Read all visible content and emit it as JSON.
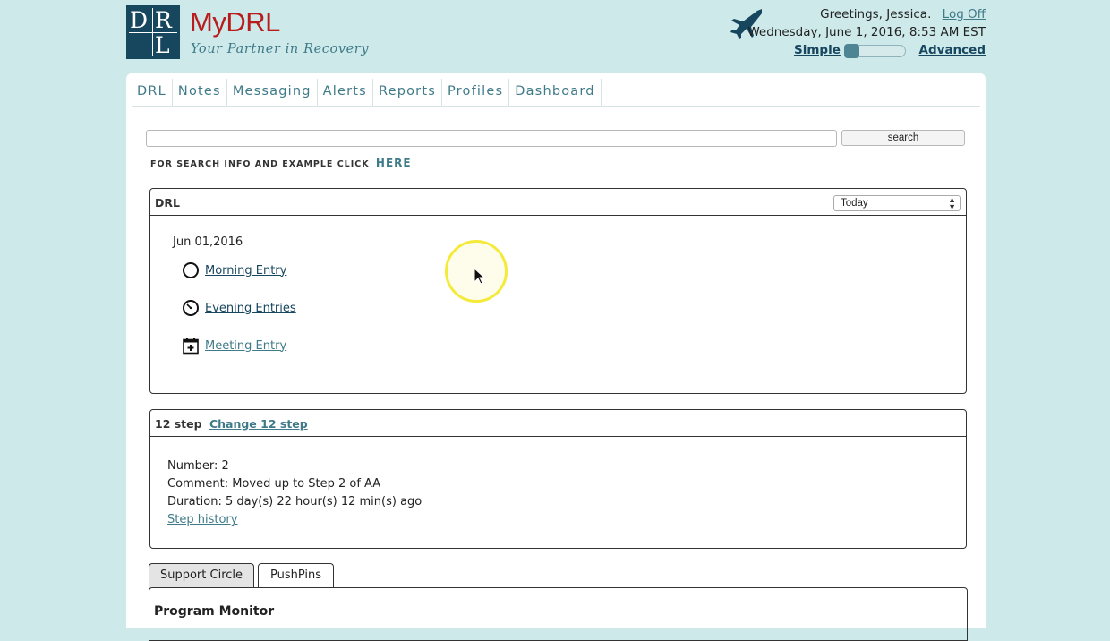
{
  "brand": {
    "logo_letters": [
      "D",
      "R",
      "L"
    ],
    "title": "MyDRL",
    "tagline": "Your Partner in Recovery",
    "color": "#b91c1c"
  },
  "header": {
    "greeting": "Greetings, Jessica.",
    "logoff_label": "Log Off",
    "datetime": "Wednesday, June 1, 2016, 8:53 AM EST",
    "mode_simple": "Simple",
    "mode_advanced": "Advanced",
    "mode_level": 0
  },
  "nav": {
    "items": [
      "DRL",
      "Notes",
      "Messaging",
      "Alerts",
      "Reports",
      "Profiles",
      "Dashboard"
    ]
  },
  "search": {
    "value": "",
    "placeholder": "",
    "button_label": "search",
    "help_text": "FOR SEARCH INFO AND EXAMPLE CLICK",
    "help_link": "HERE"
  },
  "drl_panel": {
    "title": "DRL",
    "period_select": "Today",
    "date": "Jun 01,2016",
    "entries": [
      {
        "label": "Morning Entry",
        "icon": "circle-icon"
      },
      {
        "label": "Evening Entries",
        "icon": "clock-icon"
      },
      {
        "label": "Meeting Entry",
        "icon": "calendar-plus-icon"
      }
    ]
  },
  "step_panel": {
    "title": "12 step",
    "change_link": "Change 12 step",
    "number": "Number: 2",
    "comment": "Comment: Moved up to Step 2 of AA",
    "duration": "Duration: 5 day(s) 22 hour(s) 12 min(s) ago",
    "history_link": "Step history"
  },
  "tabs": [
    "Support Circle",
    "PushPins"
  ],
  "bottom_panel": {
    "title": "Program Monitor"
  },
  "colors": {
    "background": "#cde9ea",
    "accent": "#3f7a88",
    "logo_bg": "#17465f"
  }
}
